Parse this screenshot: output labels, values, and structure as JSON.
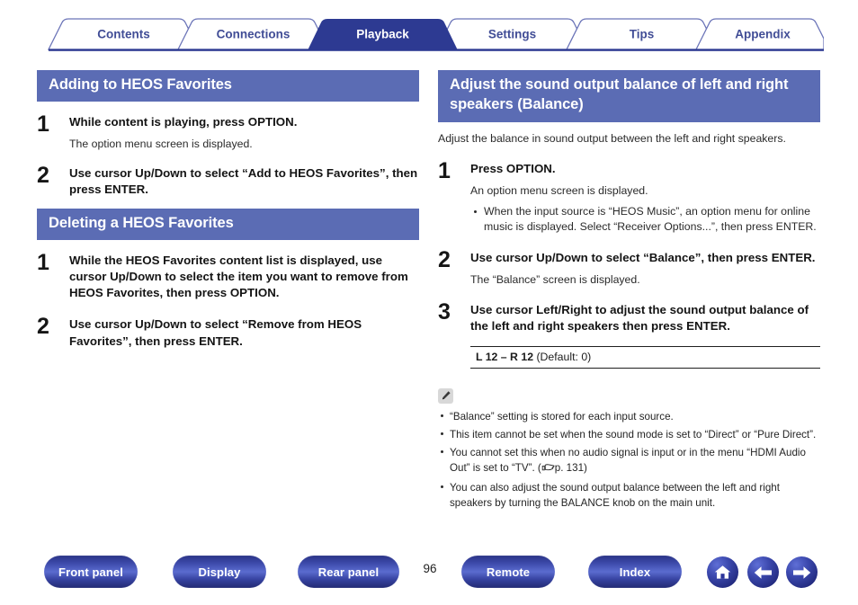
{
  "nav": {
    "tabs": [
      {
        "label": "Contents",
        "active": false
      },
      {
        "label": "Connections",
        "active": false
      },
      {
        "label": "Playback",
        "active": true
      },
      {
        "label": "Settings",
        "active": false
      },
      {
        "label": "Tips",
        "active": false
      },
      {
        "label": "Appendix",
        "active": false
      }
    ],
    "active_tab_color": "#2d3a92",
    "inactive_tab_color": "#414d96"
  },
  "theme": {
    "header_bar_color": "#5b6cb4",
    "accent_blue": "#2d3a92",
    "note_icon_bg": "#d8d8d8"
  },
  "left_column": {
    "sections": [
      {
        "heading": "Adding to HEOS Favorites",
        "steps": [
          {
            "number": "1",
            "title": "While content is playing, press OPTION.",
            "desc": "The option menu screen is displayed."
          },
          {
            "number": "2",
            "title": "Use cursor Up/Down to select “Add to HEOS Favorites”, then press ENTER.",
            "desc": ""
          }
        ]
      },
      {
        "heading": "Deleting a HEOS Favorites",
        "steps": [
          {
            "number": "1",
            "title": "While the HEOS Favorites content list is displayed, use cursor Up/Down to select the item you want to remove from HEOS Favorites, then press OPTION.",
            "desc": ""
          },
          {
            "number": "2",
            "title": "Use cursor Up/Down to select “Remove from HEOS Favorites”, then press ENTER.",
            "desc": ""
          }
        ]
      }
    ]
  },
  "right_column": {
    "heading": "Adjust the sound output balance of left and right speakers (Balance)",
    "intro": "Adjust the balance in sound output between the left and right speakers.",
    "steps": [
      {
        "number": "1",
        "title": "Press OPTION.",
        "desc": "An option menu screen is displayed.",
        "bullets": [
          "When the input source is “HEOS Music”, an option menu for online music is displayed. Select “Receiver Options...”, then press ENTER."
        ]
      },
      {
        "number": "2",
        "title": "Use cursor Up/Down to select “Balance”, then press ENTER.",
        "desc": "The “Balance” screen is displayed.",
        "bullets": []
      },
      {
        "number": "3",
        "title": "Use cursor Left/Right to adjust the sound output balance of the left and right speakers then press ENTER.",
        "desc": "",
        "bullets": []
      }
    ],
    "value_range": {
      "range": "L 12 – R 12",
      "default": "(Default: 0)"
    },
    "note": {
      "icon": "pencil-icon",
      "items": [
        {
          "pre": "“Balance” setting is stored for each input source.",
          "ref": "",
          "post": ""
        },
        {
          "pre": "This item cannot be set when the sound mode is set to “Direct” or “Pure Direct”.",
          "ref": "",
          "post": ""
        },
        {
          "pre": "You cannot set this when no audio signal is input or in the menu “HDMI Audio Out” is set to “TV”.  (",
          "ref": "p. 131",
          "post": ")"
        },
        {
          "pre": "You can also adjust the sound output balance between the left and right speakers by turning the BALANCE knob on the main unit.",
          "ref": "",
          "post": ""
        }
      ]
    }
  },
  "footer": {
    "buttons": [
      {
        "label": "Front panel"
      },
      {
        "label": "Display"
      },
      {
        "label": "Rear panel"
      },
      {
        "label": "Remote"
      },
      {
        "label": "Index"
      }
    ],
    "page_number": "96",
    "icons": [
      {
        "name": "home-icon"
      },
      {
        "name": "arrow-left-icon"
      },
      {
        "name": "arrow-right-icon"
      }
    ]
  }
}
